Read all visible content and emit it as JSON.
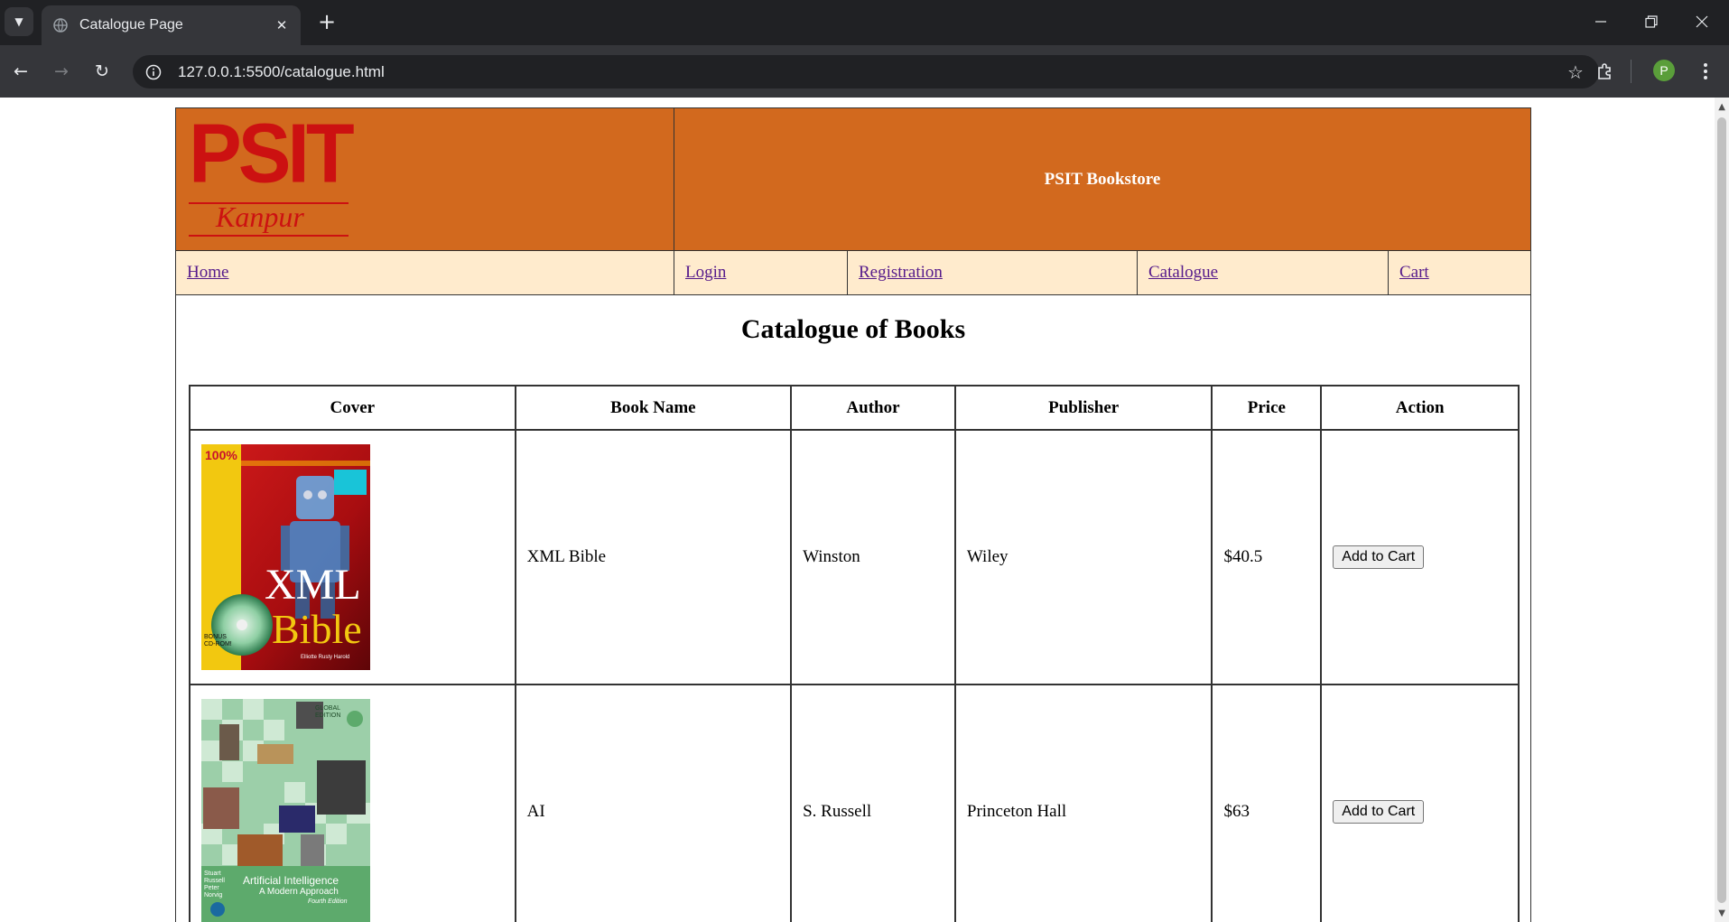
{
  "browser": {
    "tab_title": "Catalogue Page",
    "url": "127.0.0.1:5500/catalogue.html",
    "profile_initial": "P"
  },
  "site": {
    "logo_text": "PSIT",
    "logo_subtext": "Kanpur",
    "store_name": "PSIT Bookstore",
    "brand_colors": {
      "header": "#d2691e",
      "nav": "#ffebcd",
      "logo": "#cc1111"
    }
  },
  "nav": {
    "items": [
      {
        "label": "Home"
      },
      {
        "label": "Login"
      },
      {
        "label": "Registration"
      },
      {
        "label": "Catalogue"
      },
      {
        "label": "Cart"
      }
    ]
  },
  "catalogue": {
    "title": "Catalogue of Books",
    "columns": [
      "Cover",
      "Book Name",
      "Author",
      "Publisher",
      "Price",
      "Action"
    ],
    "books": [
      {
        "name": "XML Bible",
        "author": "Winston",
        "publisher": "Wiley",
        "price": "$40.5",
        "action": "Add to Cart",
        "cover": {
          "top_text": "100%",
          "title_main": "XML",
          "title_sub": "Bible",
          "author_line": "Elliotte Rusty Harold",
          "bonus": "BONUS CD-ROM!"
        }
      },
      {
        "name": "AI",
        "author": "S. Russell",
        "publisher": "Princeton Hall",
        "price": "$63",
        "action": "Add to Cart",
        "cover": {
          "edition_badge": "GLOBAL EDITION",
          "authors": "Stuart Russell Peter Norvig",
          "title_line1": "Artificial Intelligence",
          "title_line2": "A Modern Approach",
          "edition": "Fourth Edition"
        }
      }
    ]
  }
}
